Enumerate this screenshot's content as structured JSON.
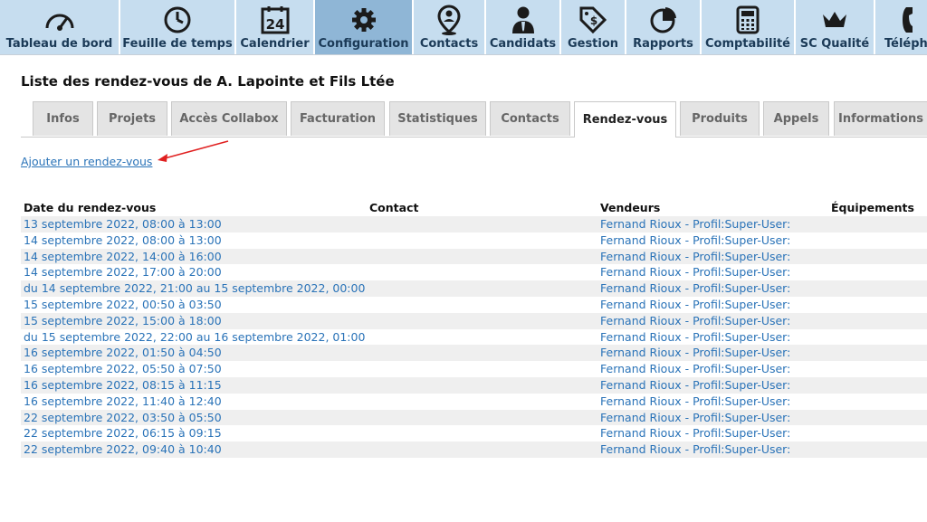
{
  "nav": {
    "items": [
      {
        "label": "Tableau de bord",
        "icon": "dashboard-gauge-icon"
      },
      {
        "label": "Feuille de temps",
        "icon": "clock-icon"
      },
      {
        "label": "Calendrier",
        "icon": "calendar-icon",
        "number": "24"
      },
      {
        "label": "Configuration",
        "icon": "gear-icon"
      },
      {
        "label": "Contacts",
        "icon": "map-pin-person-icon"
      },
      {
        "label": "Candidats",
        "icon": "person-tie-icon"
      },
      {
        "label": "Gestion",
        "icon": "price-tag-icon"
      },
      {
        "label": "Rapports",
        "icon": "pie-chart-icon"
      },
      {
        "label": "Comptabilité",
        "icon": "calculator-icon"
      },
      {
        "label": "SC Qualité",
        "icon": "crown-icon"
      },
      {
        "label": "Télépho",
        "icon": "phone-icon"
      }
    ],
    "active_index": 3
  },
  "page_title": "Liste des rendez-vous de A. Lapointe et Fils Ltée",
  "tabs": [
    "Infos",
    "Projets",
    "Accès Collabox",
    "Facturation",
    "Statistiques",
    "Contacts",
    "Rendez-vous",
    "Produits",
    "Appels",
    "Informations"
  ],
  "active_tab": "Rendez-vous",
  "add_link": "Ajouter un rendez-vous",
  "table": {
    "headers": {
      "date": "Date du rendez-vous",
      "contact": "Contact",
      "vendeurs": "Vendeurs",
      "equipements": "Équipements"
    },
    "rows": [
      {
        "date": "13 septembre 2022, 08:00 à 13:00",
        "contact": "",
        "vendeurs": "Fernand Rioux - Profil:Super-User:",
        "equipements": ""
      },
      {
        "date": "14 septembre 2022, 08:00 à 13:00",
        "contact": "",
        "vendeurs": "Fernand Rioux - Profil:Super-User:",
        "equipements": ""
      },
      {
        "date": "14 septembre 2022, 14:00 à 16:00",
        "contact": "",
        "vendeurs": "Fernand Rioux - Profil:Super-User:",
        "equipements": ""
      },
      {
        "date": "14 septembre 2022, 17:00 à 20:00",
        "contact": "",
        "vendeurs": "Fernand Rioux - Profil:Super-User:",
        "equipements": ""
      },
      {
        "date": "du 14 septembre 2022, 21:00 au 15 septembre 2022, 00:00",
        "contact": "",
        "vendeurs": "Fernand Rioux - Profil:Super-User:",
        "equipements": ""
      },
      {
        "date": "15 septembre 2022, 00:50 à 03:50",
        "contact": "",
        "vendeurs": "Fernand Rioux - Profil:Super-User:",
        "equipements": ""
      },
      {
        "date": "15 septembre 2022, 15:00 à 18:00",
        "contact": "",
        "vendeurs": "Fernand Rioux - Profil:Super-User:",
        "equipements": ""
      },
      {
        "date": "du 15 septembre 2022, 22:00 au 16 septembre 2022, 01:00",
        "contact": "",
        "vendeurs": "Fernand Rioux - Profil:Super-User:",
        "equipements": ""
      },
      {
        "date": "16 septembre 2022, 01:50 à 04:50",
        "contact": "",
        "vendeurs": "Fernand Rioux - Profil:Super-User:",
        "equipements": ""
      },
      {
        "date": "16 septembre 2022, 05:50 à 07:50",
        "contact": "",
        "vendeurs": "Fernand Rioux - Profil:Super-User:",
        "equipements": ""
      },
      {
        "date": "16 septembre 2022, 08:15 à 11:15",
        "contact": "",
        "vendeurs": "Fernand Rioux - Profil:Super-User:",
        "equipements": ""
      },
      {
        "date": "16 septembre 2022, 11:40 à 12:40",
        "contact": "",
        "vendeurs": "Fernand Rioux - Profil:Super-User:",
        "equipements": ""
      },
      {
        "date": "22 septembre 2022, 03:50 à 05:50",
        "contact": "",
        "vendeurs": "Fernand Rioux - Profil:Super-User:",
        "equipements": ""
      },
      {
        "date": "22 septembre 2022, 06:15 à 09:15",
        "contact": "",
        "vendeurs": "Fernand Rioux - Profil:Super-User:",
        "equipements": ""
      },
      {
        "date": "22 septembre 2022, 09:40 à 10:40",
        "contact": "",
        "vendeurs": "Fernand Rioux - Profil:Super-User:",
        "equipements": ""
      }
    ]
  },
  "colors": {
    "link": "#2a73b8",
    "nav_bg": "#c6ddef",
    "nav_active": "#8fb6d6",
    "annotation_arrow": "#e02020"
  }
}
